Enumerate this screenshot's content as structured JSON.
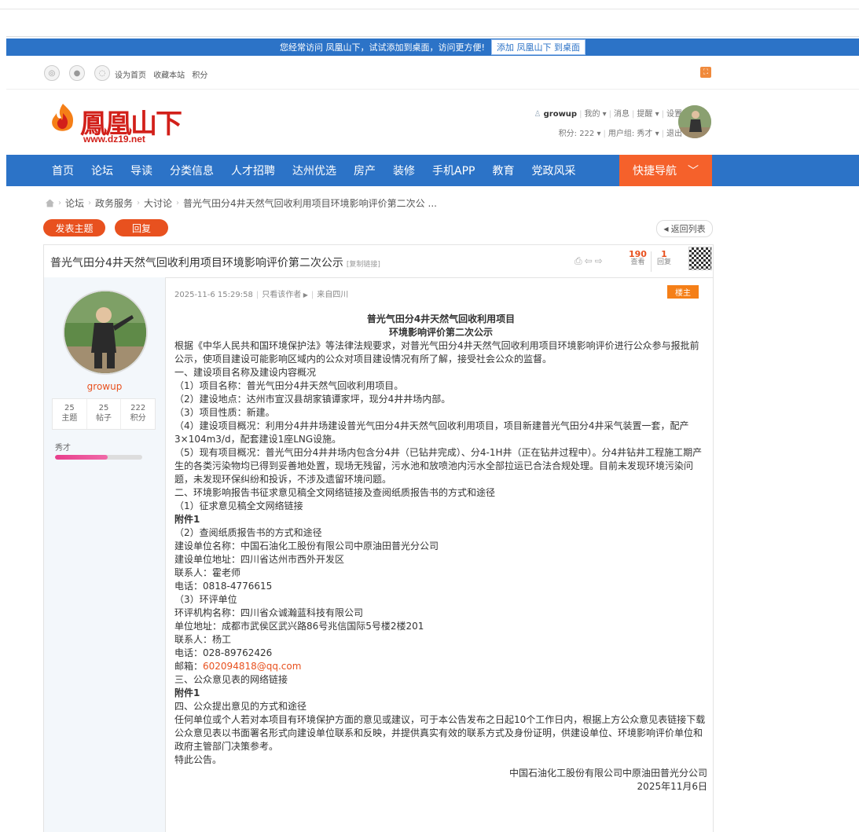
{
  "promo": {
    "text": "您经常访问 凤凰山下，试试添加到桌面，访问更方便!",
    "button": "添加 凤凰山下 到桌面"
  },
  "toolbar": {
    "set_home": "设为首页",
    "bookmark": "收藏本站",
    "points": "积分"
  },
  "logo": {
    "name": "鳳凰山下",
    "url": "www.dz19.net"
  },
  "user": {
    "name": "growup",
    "mine": "我的",
    "messages": "消息",
    "reminders": "提醒",
    "settings": "设置",
    "points_label": "积分: 222",
    "group_label": "用户组: 秀才",
    "logout": "退出"
  },
  "nav": {
    "items": [
      "首页",
      "论坛",
      "导读",
      "分类信息",
      "人才招聘",
      "达州优选",
      "房产",
      "装修",
      "手机APP",
      "教育",
      "党政风采"
    ],
    "quick": "快捷导航"
  },
  "breadcrumb": {
    "items": [
      "论坛",
      "政务服务",
      "大讨论",
      "普光气田分4井天然气回收利用项目环境影响评价第二次公 ..."
    ]
  },
  "actions": {
    "new_thread": "发表主题",
    "reply": "回复",
    "back": "返回列表"
  },
  "thread": {
    "title": "普光气田分4井天然气回收利用项目环境影响评价第二次公示",
    "copy_link": "[复制链接]",
    "views": "190",
    "views_label": "查看",
    "replies": "1",
    "replies_label": "回复"
  },
  "author": {
    "name": "growup",
    "stats": [
      {
        "value": "25",
        "label": "主题"
      },
      {
        "value": "25",
        "label": "帖子"
      },
      {
        "value": "222",
        "label": "积分"
      }
    ],
    "group": "秀才",
    "progress": 0.6
  },
  "post": {
    "datetime": "2025-11-6 15:29:58",
    "only_author": "只看该作者",
    "from": "来自四川",
    "floor": "楼主",
    "heading1": "普光气田分4井天然气回收利用项目",
    "heading2": "环境影响评价第二次公示",
    "p1": "根据《中华人民共和国环境保护法》等法律法规要求，对普光气田分4井天然气回收利用项目环境影响评价进行公众参与报批前公示，使项目建设可能影响区域内的公众对项目建设情况有所了解，接受社会公众的监督。",
    "l1": "一、建设项目名称及建设内容概况",
    "l2": "（1）项目名称：普光气田分4井天然气回收利用项目。",
    "l3": "（2）建设地点：达州市宣汉县胡家镇谭家坪，现分4井井场内部。",
    "l4": "（3）项目性质：新建。",
    "l5": "（4）建设项目概况：利用分4井井场建设普光气田分4井天然气回收利用项目，项目新建普光气田分4井采气装置一套，配产3×104m3/d，配套建设1座LNG设施。",
    "l6": "（5）现有项目概况：普光气田分4井井场内包含分4井（已钻井完成）、分4-1H井（正在钻井过程中）。分4井钻井工程施工期产生的各类污染物均已得到妥善地处置，现场无残留，污水池和放喷池内污水全部拉运已合法合规处理。目前未发现环境污染问题，未发现环保纠纷和投诉，不涉及遗留环境问题。",
    "l7": "二、环境影响报告书征求意见稿全文网络链接及查阅纸质报告书的方式和途径",
    "l8": "（1）征求意见稿全文网络链接",
    "l9": "附件1",
    "l10": "（2）查阅纸质报告书的方式和途径",
    "l11": "建设单位名称：中国石油化工股份有限公司中原油田普光分公司",
    "l12": "建设单位地址：四川省达州市西外开发区",
    "l13": "联系人：霍老师",
    "l14": "电话：0818-4776615",
    "l15": "（3）环评单位",
    "l16": "环评机构名称：四川省众诚瀚蓝科技有限公司",
    "l17": "单位地址：成都市武侯区武兴路86号兆信国际5号楼2楼201",
    "l18": "联系人：杨工",
    "l19": "电话：028-89762426",
    "mail_label": "邮箱：",
    "mail": "602094818@qq.com",
    "l20": "三、公众意见表的网络链接",
    "l21": "附件1",
    "l22": "四、公众提出意见的方式和途径",
    "p2": "任何单位或个人若对本项目有环境保护方面的意见或建议，可于本公告发布之日起10个工作日内，根据上方公众意见表链接下载公众意见表以书面署名形式向建设单位联系和反映，并提供真实有效的联系方式及身份证明，供建设单位、环境影响评价单位和政府主管部门决策参考。",
    "l23": "特此公告。",
    "sign1": "中国石油化工股份有限公司中原油田普光分公司",
    "sign2": "2025年11月6日"
  },
  "colors": {
    "brand_blue": "#2c73c7",
    "accent_orange": "#e8511f",
    "quicknav": "#f5612b"
  }
}
